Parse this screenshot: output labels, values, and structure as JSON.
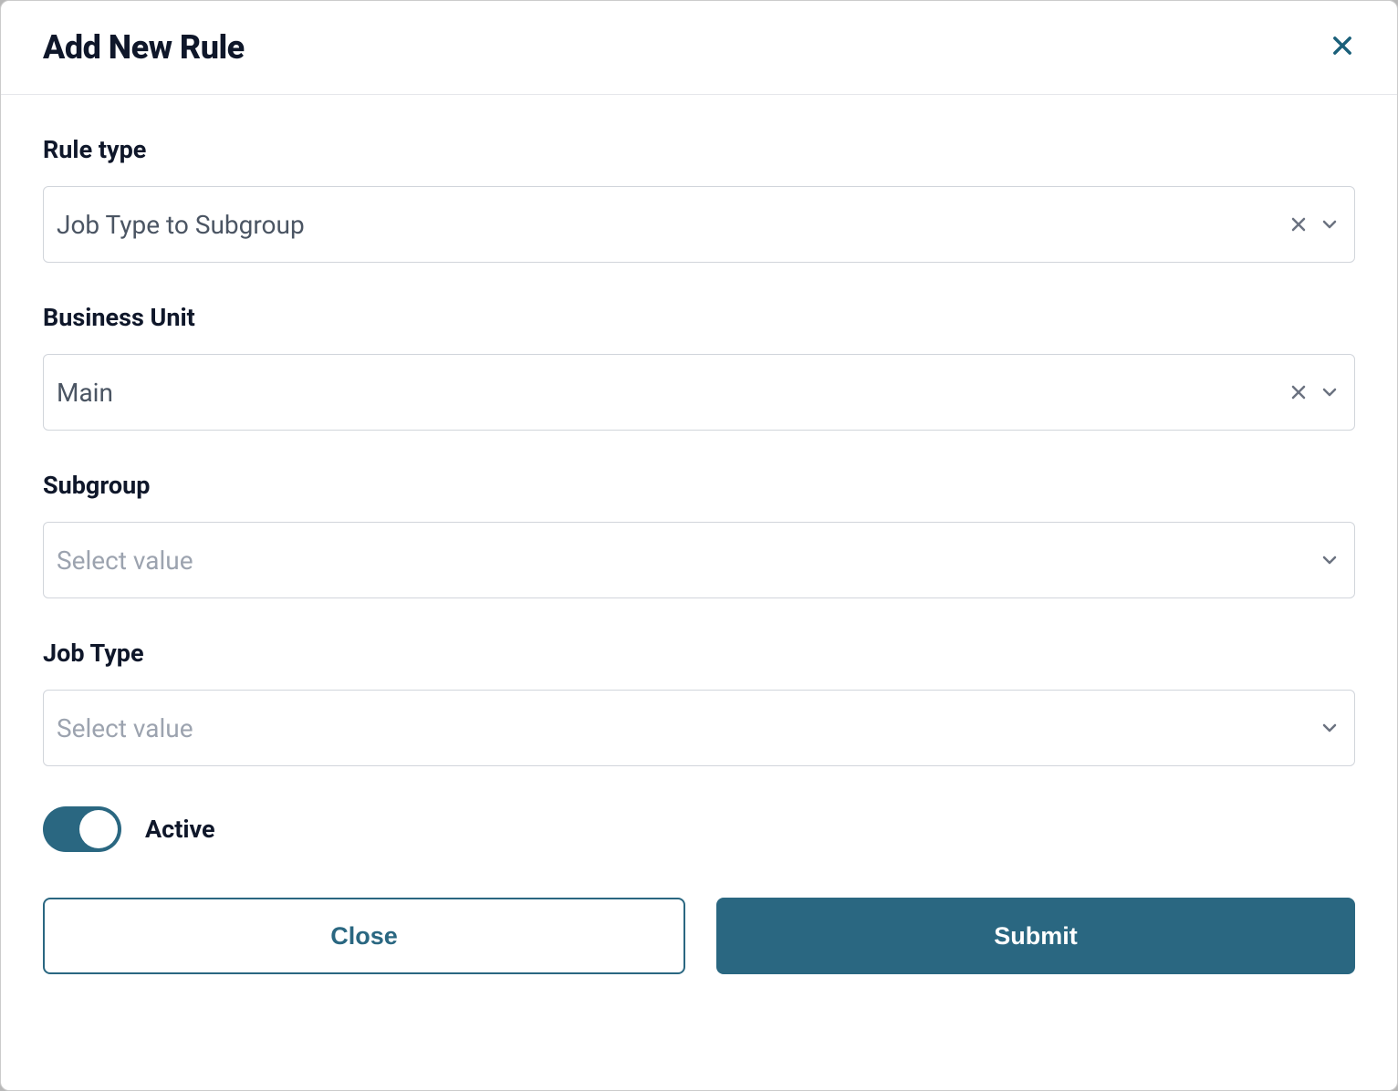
{
  "modal": {
    "title": "Add New Rule",
    "close_icon": "close-icon"
  },
  "fields": {
    "rule_type": {
      "label": "Rule type",
      "value": "Job Type to Subgroup"
    },
    "business_unit": {
      "label": "Business Unit",
      "value": "Main"
    },
    "subgroup": {
      "label": "Subgroup",
      "placeholder": "Select value"
    },
    "job_type": {
      "label": "Job Type",
      "placeholder": "Select value"
    }
  },
  "toggle": {
    "label": "Active",
    "on": true
  },
  "buttons": {
    "close": "Close",
    "submit": "Submit"
  }
}
